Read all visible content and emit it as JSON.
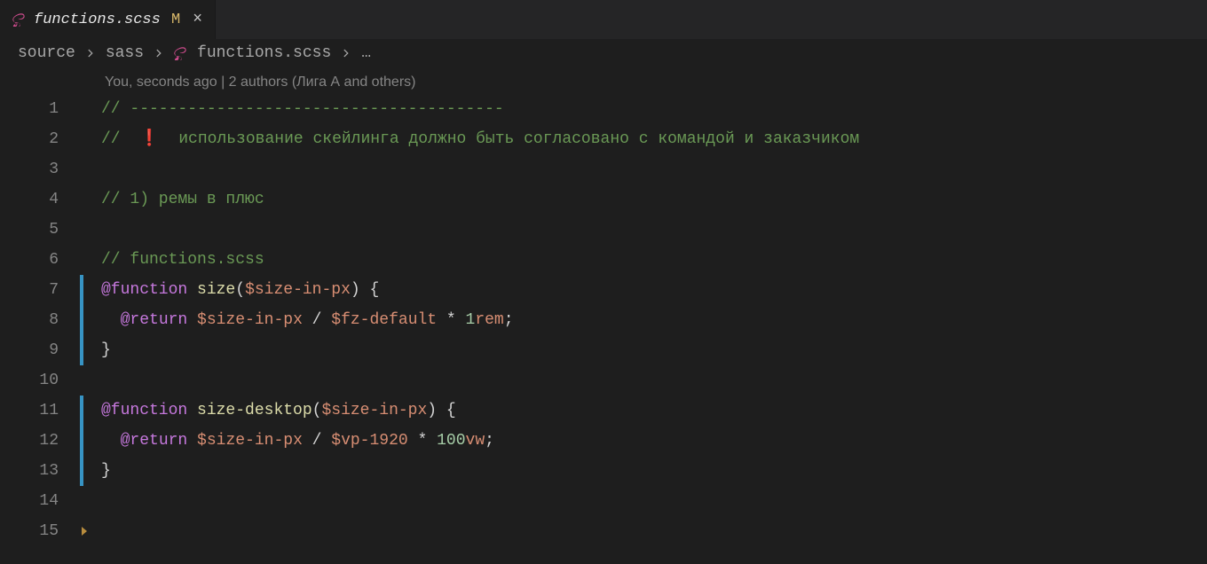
{
  "tab": {
    "filename": "functions.scss",
    "modified_marker": "M",
    "close_symbol": "×"
  },
  "breadcrumbs": {
    "parts": [
      "source",
      "sass",
      "functions.scss"
    ],
    "ellipsis": "…"
  },
  "codelens": "You, seconds ago | 2 authors (Лига А and others)",
  "lines": {
    "l1": {
      "num": "1",
      "comment": "// ---------------------------------------"
    },
    "l2": {
      "num": "2",
      "prefix": "//  ",
      "exclaim": "❗",
      "rest": "  использование скейлинга должно быть согласовано с командой и заказчиком"
    },
    "l3": {
      "num": "3"
    },
    "l4": {
      "num": "4",
      "comment": "// 1) ремы в плюс"
    },
    "l5": {
      "num": "5"
    },
    "l6": {
      "num": "6",
      "comment": "// functions.scss"
    },
    "l7": {
      "num": "7",
      "kw": "@function",
      "sp1": " ",
      "fn": "size",
      "open": "(",
      "arg": "$size-in-px",
      "close": ") {"
    },
    "l8": {
      "num": "8",
      "indent": "  ",
      "kw": "@return",
      "sp1": " ",
      "v1": "$size-in-px",
      "op1": " / ",
      "v2": "$fz-default",
      "op2": " * ",
      "num2": "1",
      "unit": "rem",
      "semi": ";"
    },
    "l9": {
      "num": "9",
      "brace": "}"
    },
    "l10": {
      "num": "10"
    },
    "l11": {
      "num": "11",
      "kw": "@function",
      "sp1": " ",
      "fn": "size-desktop",
      "open": "(",
      "arg": "$size-in-px",
      "close": ") {"
    },
    "l12": {
      "num": "12",
      "indent": "  ",
      "kw": "@return",
      "sp1": " ",
      "v1": "$size-in-px",
      "op1": " / ",
      "v2": "$vp-1920",
      "op2": " * ",
      "num2": "100",
      "unit": "vw",
      "semi": ";"
    },
    "l13": {
      "num": "13",
      "brace": "}"
    },
    "l14": {
      "num": "14"
    },
    "l15": {
      "num": "15"
    }
  }
}
